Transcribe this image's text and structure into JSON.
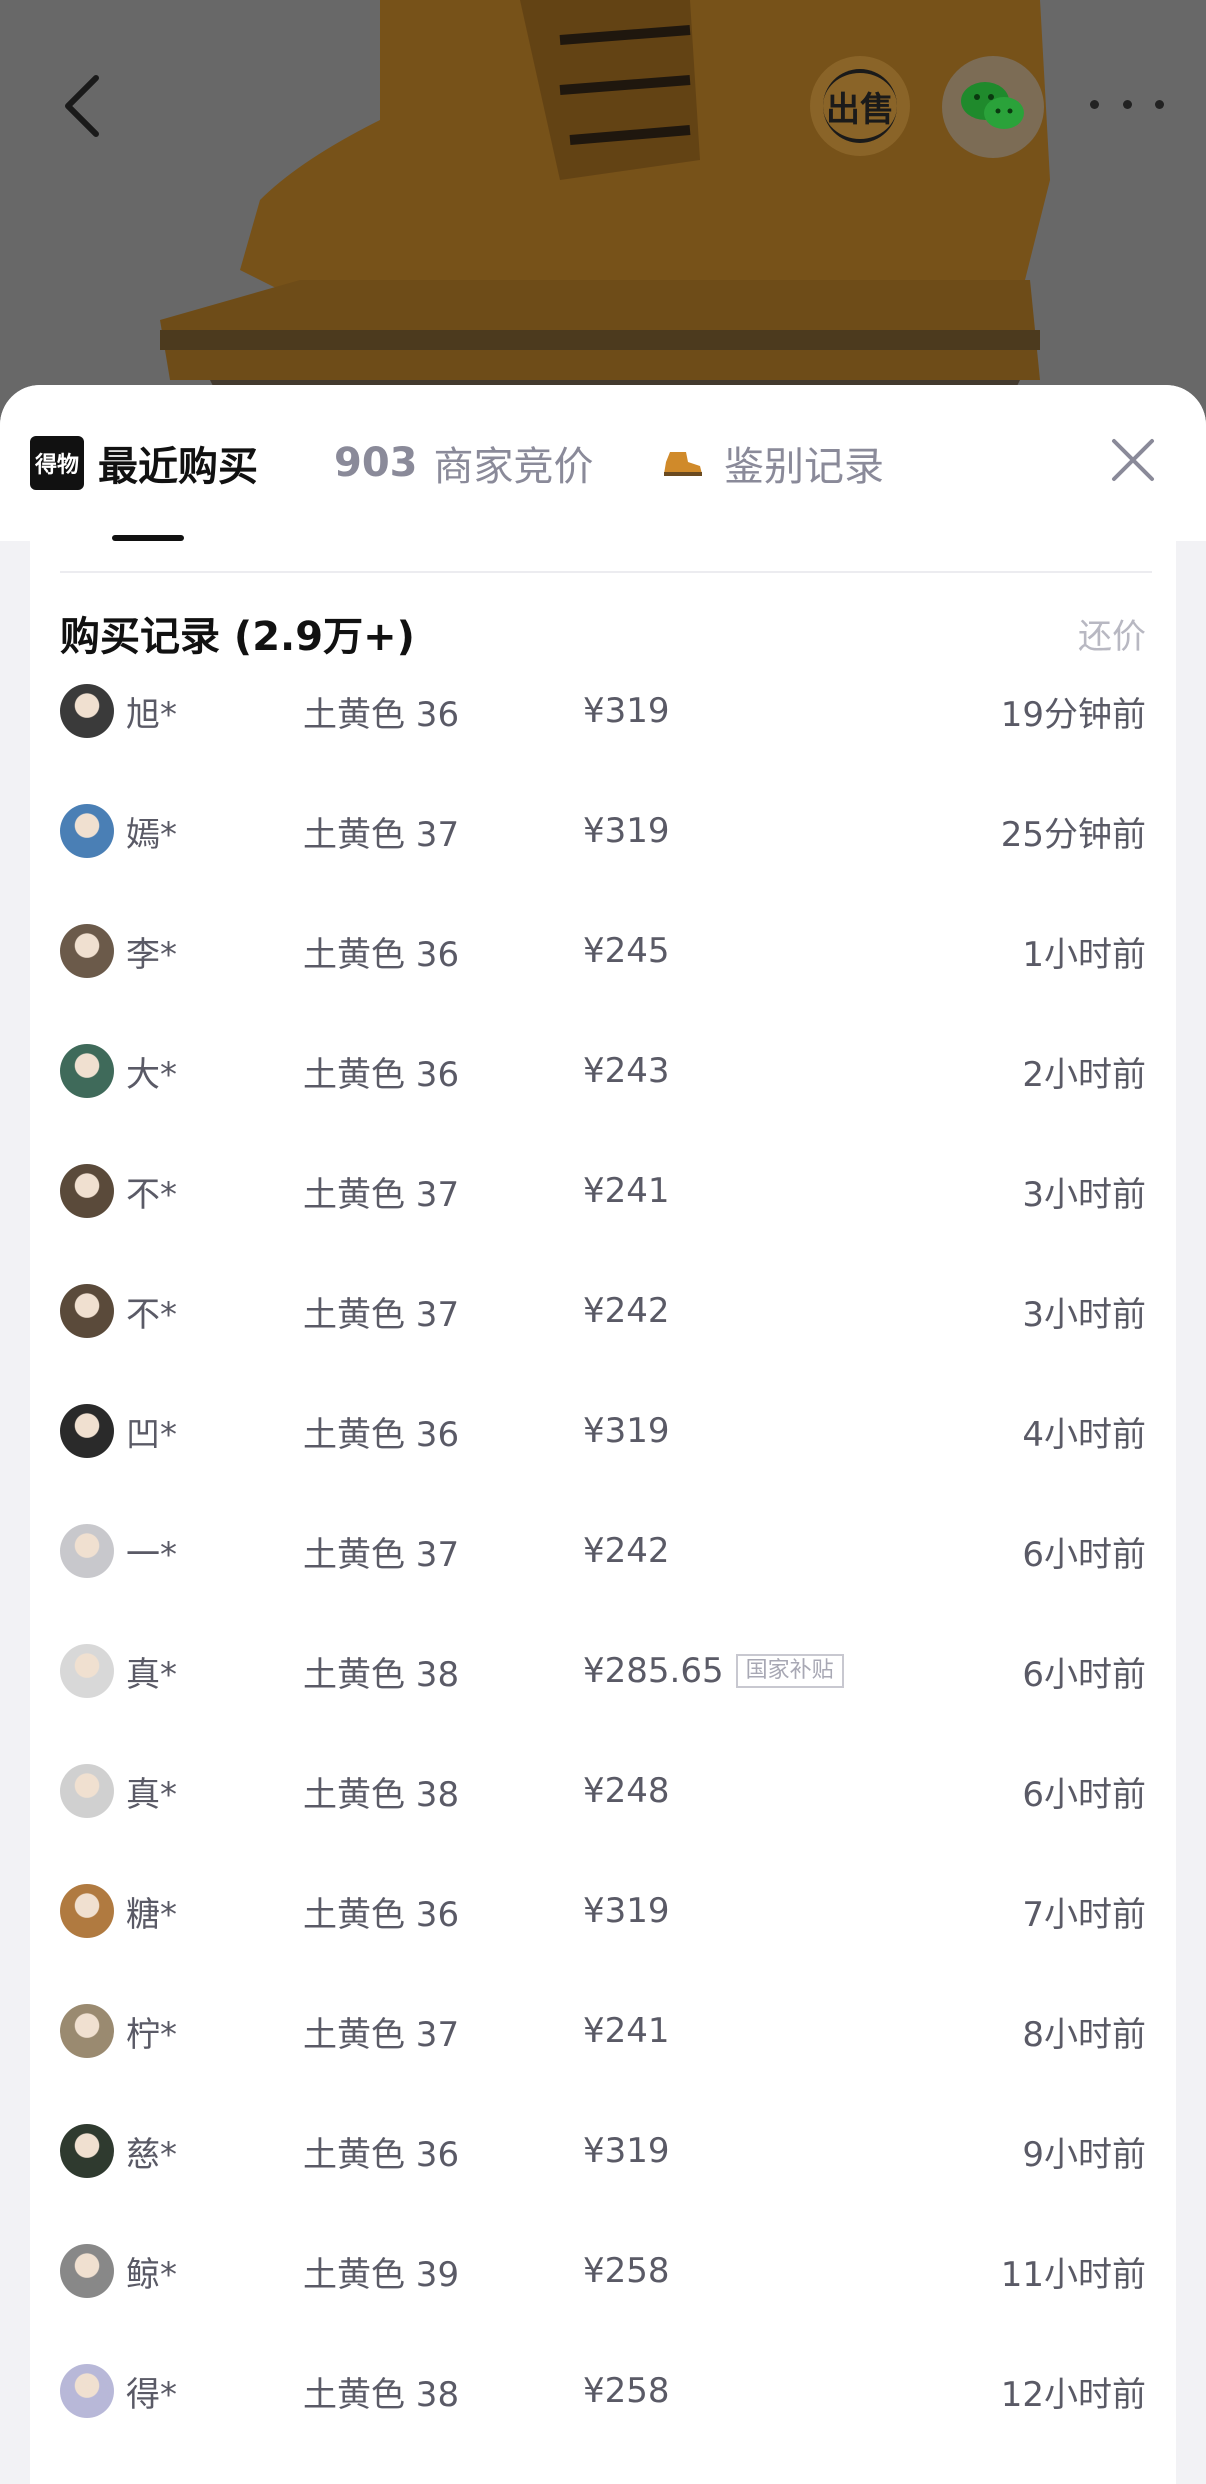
{
  "header": {
    "sell_label": "出售",
    "icons": {
      "back": "back-arrow-icon",
      "wechat": "wechat-icon",
      "more": "more-dots-icon"
    }
  },
  "tabs": {
    "logo_text": "得物",
    "recent_label": "最近购买",
    "bid_count": "903",
    "bid_label": "商家竞价",
    "auth_label": "鉴别记录",
    "close_icon": "close-icon"
  },
  "records": {
    "title": "购买记录 (2.9万+)",
    "counter_offer": "还价",
    "subsidy_badge": "国家补贴",
    "rows": [
      {
        "name": "旭*",
        "spec": "土黄色 36",
        "price": "¥319",
        "time": "19分钟前",
        "avatar": "#3a3a3a"
      },
      {
        "name": "嫣*",
        "spec": "土黄色 37",
        "price": "¥319",
        "time": "25分钟前",
        "avatar": "#4a7fb5"
      },
      {
        "name": "李*",
        "spec": "土黄色 36",
        "price": "¥245",
        "time": "1小时前",
        "avatar": "#6b5a4a"
      },
      {
        "name": "大*",
        "spec": "土黄色 36",
        "price": "¥243",
        "time": "2小时前",
        "avatar": "#3f6a5a"
      },
      {
        "name": "不*",
        "spec": "土黄色 37",
        "price": "¥241",
        "time": "3小时前",
        "avatar": "#5a4a3a"
      },
      {
        "name": "不*",
        "spec": "土黄色 37",
        "price": "¥242",
        "time": "3小时前",
        "avatar": "#5a4a3a"
      },
      {
        "name": "凹*",
        "spec": "土黄色 36",
        "price": "¥319",
        "time": "4小时前",
        "avatar": "#2a2a2a"
      },
      {
        "name": "一*",
        "spec": "土黄色 37",
        "price": "¥242",
        "time": "6小时前",
        "avatar": "#c8c8cc"
      },
      {
        "name": "真*",
        "spec": "土黄色 38",
        "price": "¥285.65",
        "time": "6小时前",
        "avatar": "#d8d8d8",
        "subsidy": true
      },
      {
        "name": "真*",
        "spec": "土黄色 38",
        "price": "¥248",
        "time": "6小时前",
        "avatar": "#d0d0d0"
      },
      {
        "name": "糖*",
        "spec": "土黄色 36",
        "price": "¥319",
        "time": "7小时前",
        "avatar": "#b07a40"
      },
      {
        "name": "柠*",
        "spec": "土黄色 37",
        "price": "¥241",
        "time": "8小时前",
        "avatar": "#9a8a70"
      },
      {
        "name": "慈*",
        "spec": "土黄色 36",
        "price": "¥319",
        "time": "9小时前",
        "avatar": "#2f3a2f"
      },
      {
        "name": "鲸*",
        "spec": "土黄色 39",
        "price": "¥258",
        "time": "11小时前",
        "avatar": "#888"
      },
      {
        "name": "得*",
        "spec": "土黄色 38",
        "price": "¥258",
        "time": "12小时前",
        "avatar": "#b8b8d8"
      }
    ]
  }
}
